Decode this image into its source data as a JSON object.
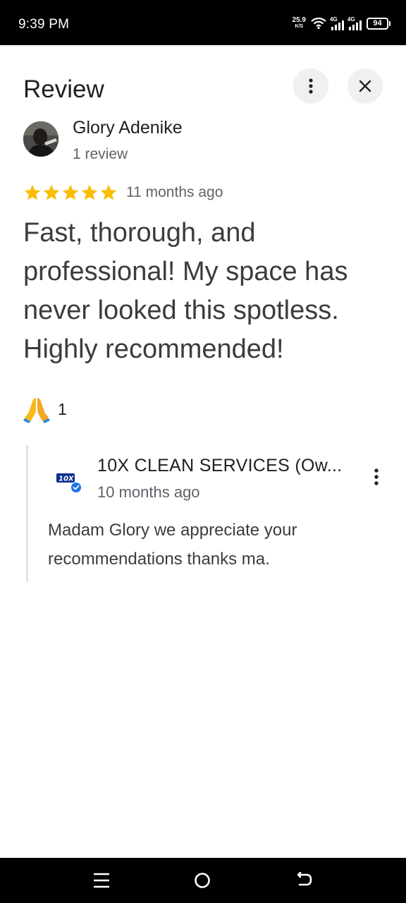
{
  "status_bar": {
    "time": "9:39 PM",
    "net_speed_value": "25.9",
    "net_speed_unit": "K/S",
    "sim1_label": "4G",
    "sim2_label": "4G",
    "battery": "94"
  },
  "header": {
    "title": "Review",
    "more_icon": "more-vert-icon",
    "close_icon": "close-icon"
  },
  "review": {
    "author": "Glory Adenike",
    "author_meta": "1 review",
    "rating": 5,
    "date": "11 months ago",
    "text": "Fast, thorough, and professional! My space has never looked this spotless. Highly recommended!",
    "reaction_icon": "folded-hands-emoji",
    "reaction_count": "1"
  },
  "owner_reply": {
    "logo_text": "10X",
    "owner_name": "10X CLEAN SERVICES (Ow...",
    "date": "10 months ago",
    "text": "Madam Glory we appreciate your recommendations thanks ma."
  },
  "nav_bar": {
    "menu_icon": "recents-icon",
    "home_icon": "home-icon",
    "back_icon": "back-icon"
  },
  "colors": {
    "star": "#fbbc04",
    "verified": "#1a73e8",
    "secondary_text": "#5f6368",
    "button_bg": "#eef0f1"
  }
}
